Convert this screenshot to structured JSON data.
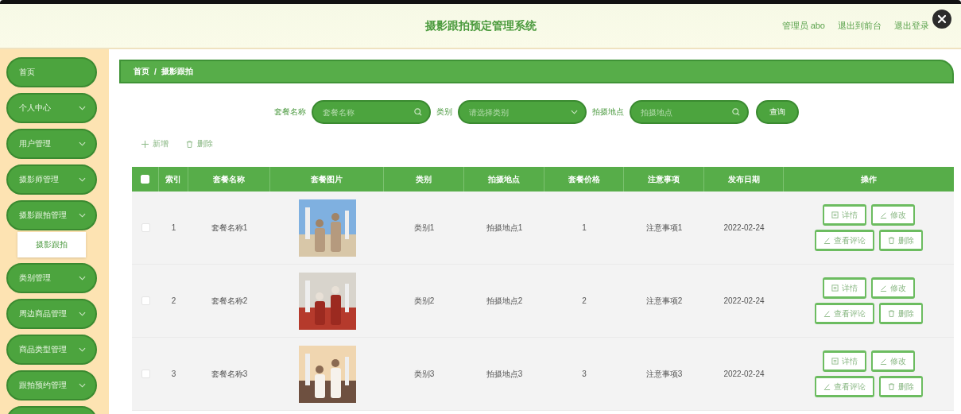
{
  "header": {
    "title": "摄影跟拍预定管理系统",
    "user": "管理员 abo",
    "links": [
      "退出到前台",
      "退出登录"
    ]
  },
  "sidebar": {
    "items": [
      {
        "label": "首页",
        "kind": "link"
      },
      {
        "label": "个人中心",
        "kind": "menu"
      },
      {
        "label": "用户管理",
        "kind": "menu"
      },
      {
        "label": "摄影师管理",
        "kind": "menu"
      },
      {
        "label": "摄影跟拍管理",
        "kind": "menu",
        "children": [
          {
            "label": "摄影跟拍"
          }
        ]
      },
      {
        "label": "类别管理",
        "kind": "menu"
      },
      {
        "label": "周边商品管理",
        "kind": "menu"
      },
      {
        "label": "商品类型管理",
        "kind": "menu"
      },
      {
        "label": "跟拍预约管理",
        "kind": "menu"
      },
      {
        "kind": "stub"
      }
    ]
  },
  "breadcrumb": {
    "items": [
      "首页",
      "摄影跟拍"
    ],
    "separator": "/"
  },
  "search": {
    "fields": [
      {
        "label": "套餐名称",
        "placeholder": "套餐名称",
        "kind": "text"
      },
      {
        "label": "类别",
        "placeholder": "请选择类别",
        "kind": "select"
      },
      {
        "label": "拍摄地点",
        "placeholder": "拍摄地点",
        "kind": "text"
      }
    ],
    "button": "查询"
  },
  "actions": [
    {
      "label": "新增",
      "kind": "add"
    },
    {
      "label": "删除",
      "kind": "delete"
    }
  ],
  "table": {
    "select_all": {
      "checked": false
    },
    "columns": [
      "索引",
      "套餐名称",
      "套餐图片",
      "类别",
      "拍摄地点",
      "套餐价格",
      "注意事项",
      "发布日期",
      "操作"
    ],
    "rows": [
      {
        "checked": false,
        "cells": [
          "1",
          "套餐名称1",
          {
            "kind": "picture"
          },
          "类别1",
          "拍摄地点1",
          "1",
          "注意事项1",
          "2022-02-24"
        ],
        "buttons": [
          {
            "label": "详情",
            "kind": "detail"
          },
          {
            "label": "修改",
            "kind": "edit"
          },
          {
            "label": "查看评论",
            "kind": "edit"
          },
          {
            "label": "删除",
            "kind": "delete"
          }
        ]
      },
      {
        "checked": false,
        "cells": [
          "2",
          "套餐名称2",
          {
            "kind": "picture"
          },
          "类别2",
          "拍摄地点2",
          "2",
          "注意事项2",
          "2022-02-24"
        ],
        "buttons": [
          {
            "label": "详情",
            "kind": "detail"
          },
          {
            "label": "修改",
            "kind": "edit"
          },
          {
            "label": "查看评论",
            "kind": "edit"
          },
          {
            "label": "删除",
            "kind": "delete"
          }
        ]
      },
      {
        "checked": false,
        "cells": [
          "3",
          "套餐名称3",
          {
            "kind": "picture"
          },
          "类别3",
          "拍摄地点3",
          "3",
          "注意事项3",
          "2022-02-24"
        ],
        "buttons": [
          {
            "label": "详情",
            "kind": "detail"
          },
          {
            "label": "修改",
            "kind": "edit"
          },
          {
            "label": "查看评论",
            "kind": "edit"
          },
          {
            "label": "删除",
            "kind": "delete"
          }
        ]
      }
    ]
  }
}
